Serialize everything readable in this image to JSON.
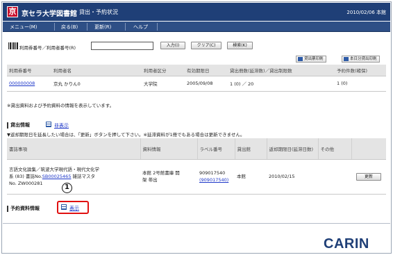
{
  "header": {
    "logo_char": "京",
    "title": "京セラ大学図書館",
    "subtitle": "貸出・予約状況",
    "date": "2010/02/06 本館"
  },
  "menu": {
    "items": [
      "メニュー(M)",
      "戻る(B)",
      "更新(R)",
      "ヘルプ"
    ]
  },
  "search": {
    "label": "利用券番号／利用者番号(R)",
    "input_value": "",
    "input_button": "入力(I)",
    "clear_button": "クリア(C)",
    "search_button": "検索(K)"
  },
  "toolbar": {
    "print_loans": "貸出票印刷",
    "print_today": "本日分貸出印刷"
  },
  "user_table": {
    "headers": [
      "利用券番号",
      "利用者名",
      "利用者区分",
      "有効期限日",
      "貸出冊数(延滞数)／貸出制限数",
      "予約件数(確保)"
    ],
    "rows": [
      [
        "000000008",
        "京丸 かりん0",
        "大学院",
        "2005/09/08",
        "1 (0) ／ 20",
        "1 (0)"
      ]
    ]
  },
  "note": "※貸出資料および予約資料の情報を表示しています。",
  "loan_section": {
    "title": "貸出情報",
    "toggle": "非表示",
    "note": "▼返却期限日を延長したい場合は、「更新」ボタンを押して下さい。※延滞資料が1冊でもある場合は更新できません。",
    "headers": [
      "書誌事項",
      "資料情報",
      "ラベル番号",
      "貸出館",
      "返却期限日(延滞日数)",
      "その他",
      ""
    ],
    "rows": [
      {
        "title_line1": "言語文化論集／筑波大学現代語・現代文化学",
        "title_line2_pre": "系 (83)  書誌No.",
        "bib_no": "SB00025465",
        "title_line2_post": " 雑誌マスタ",
        "ncid": "No. ZW000281",
        "material_line1": "本館 2号館書庫 開",
        "material_line2": "架 帯出",
        "label_line1": "909017540",
        "label_link": "(909017540)",
        "branch": "本館",
        "due": "2010/02/15",
        "other": "",
        "renew": "更新"
      }
    ]
  },
  "reserve_section": {
    "title": "予約資料情報",
    "toggle": "表示"
  },
  "callout": {
    "number": "1"
  },
  "brand": "CARIN"
}
